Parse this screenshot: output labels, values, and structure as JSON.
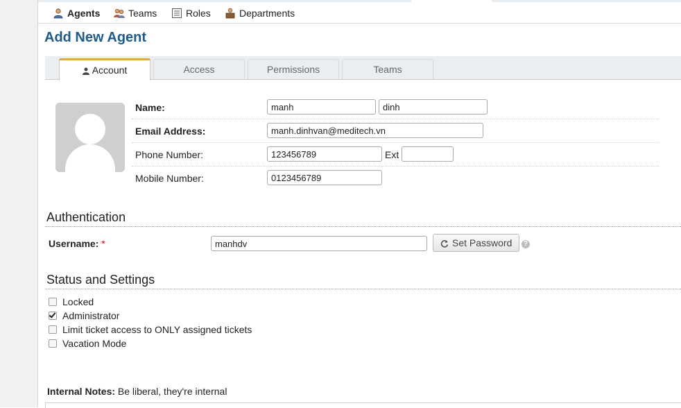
{
  "subnav": {
    "items": [
      {
        "label": "Agents",
        "icon": "agent-icon",
        "active": true
      },
      {
        "label": "Teams",
        "icon": "teams-icon"
      },
      {
        "label": "Roles",
        "icon": "roles-icon"
      },
      {
        "label": "Departments",
        "icon": "departments-icon"
      }
    ]
  },
  "page": {
    "title": "Add New Agent"
  },
  "tabs": [
    {
      "label": "Account",
      "active": true,
      "icon": "user-icon"
    },
    {
      "label": "Access"
    },
    {
      "label": "Permissions"
    },
    {
      "label": "Teams"
    }
  ],
  "account": {
    "name_label": "Name:",
    "first_name": "manh",
    "last_name": "dinh",
    "email_label": "Email Address:",
    "email": "manh.dinhvan@meditech.vn",
    "phone_label": "Phone Number:",
    "phone": "123456789",
    "ext_label": "Ext",
    "ext": "",
    "mobile_label": "Mobile Number:",
    "mobile": "0123456789"
  },
  "auth": {
    "title": "Authentication",
    "username_label": "Username:",
    "required_mark": "*",
    "username": "manhdv",
    "set_password_label": "Set Password",
    "help": "?"
  },
  "status": {
    "title": "Status and Settings",
    "options": [
      {
        "label": "Locked",
        "checked": false
      },
      {
        "label": "Administrator",
        "checked": true
      },
      {
        "label": "Limit ticket access to ONLY assigned tickets",
        "checked": false
      },
      {
        "label": "Vacation Mode",
        "checked": false
      }
    ]
  },
  "notes": {
    "label": "Internal Notes:",
    "hint": "Be liberal, they're internal"
  },
  "colors": {
    "title_blue": "#1d5b8a",
    "tab_accent": "#e0aa44",
    "required_red": "#cc0000"
  }
}
